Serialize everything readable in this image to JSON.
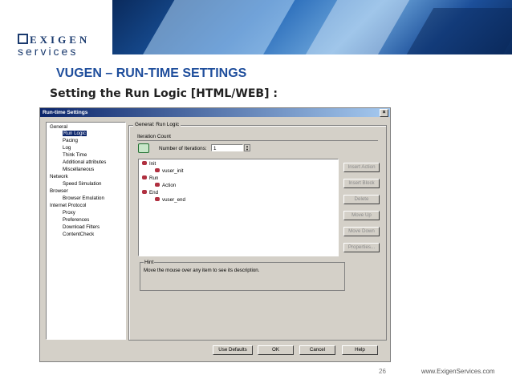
{
  "slide": {
    "logo_top": "EXIGEN",
    "logo_bottom": "services",
    "title": "VUGEN – RUN-TIME SETTINGS",
    "subtitle": "Setting the Run Logic [HTML/WEB] :",
    "page_number": "26",
    "website": "www.ExigenServices.com"
  },
  "window": {
    "title": "Run-time Settings",
    "close_glyph": "×",
    "tree": [
      {
        "label": "General",
        "level": 0
      },
      {
        "label": "Run Logic",
        "level": 1,
        "selected": true
      },
      {
        "label": "Pacing",
        "level": 1
      },
      {
        "label": "Log",
        "level": 1
      },
      {
        "label": "Think Time",
        "level": 1
      },
      {
        "label": "Additional attributes",
        "level": 1
      },
      {
        "label": "Miscellaneous",
        "level": 1
      },
      {
        "label": "Network",
        "level": 0
      },
      {
        "label": "Speed Simulation",
        "level": 1
      },
      {
        "label": "Browser",
        "level": 0
      },
      {
        "label": "Browser Emulation",
        "level": 1
      },
      {
        "label": "Internet Protocol",
        "level": 0
      },
      {
        "label": "Proxy",
        "level": 1
      },
      {
        "label": "Preferences",
        "level": 1
      },
      {
        "label": "Download Filters",
        "level": 1
      },
      {
        "label": "ContentCheck",
        "level": 1
      }
    ],
    "group_title": "General: Run Logic",
    "iteration_section": "Iteration Count",
    "iterations_label": "Number of Iterations:",
    "iterations_value": "1",
    "action_tree": [
      {
        "label": "Init",
        "level": 0
      },
      {
        "label": "vuser_init",
        "level": 1
      },
      {
        "label": "Run",
        "level": 0
      },
      {
        "label": "Action",
        "level": 1
      },
      {
        "label": "End",
        "level": 0
      },
      {
        "label": "vuser_end",
        "level": 1
      }
    ],
    "side_buttons": {
      "insert_action": "Insert Action",
      "insert_block": "Insert Block",
      "delete": "Delete",
      "move_up": "Move Up",
      "move_down": "Move Down",
      "properties": "Properties..."
    },
    "hint_title": "Hint",
    "hint_text": "Move the mouse over any item to see its description.",
    "bottom_buttons": {
      "use_defaults": "Use Defaults",
      "ok": "OK",
      "cancel": "Cancel",
      "help": "Help"
    }
  }
}
